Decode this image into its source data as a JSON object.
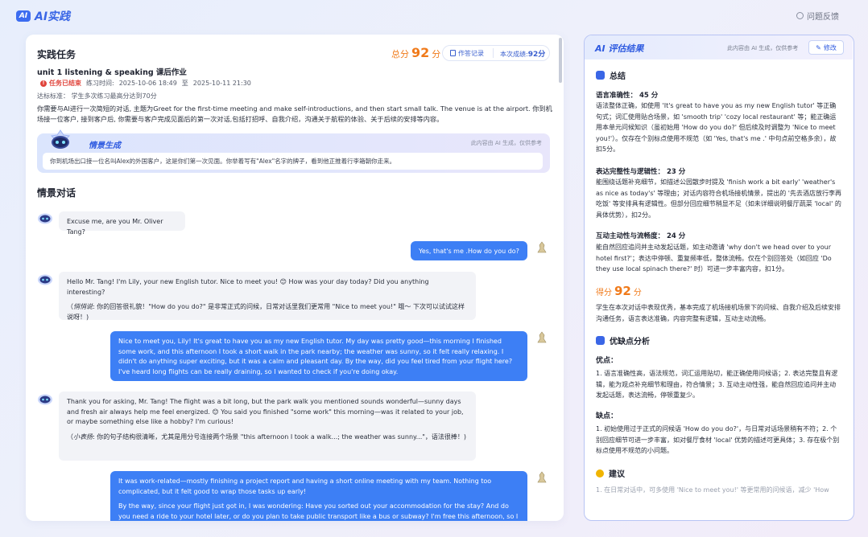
{
  "app": {
    "logo_badge": "AI",
    "logo_text": "AI实践",
    "feedback_label": "问题反馈"
  },
  "task": {
    "section_title": "实践任务",
    "total_score_prefix": "总分",
    "total_score": "92",
    "total_score_suffix": "分",
    "record_label": "作答记录",
    "current_score_label": "本次成绩:",
    "current_score_value": "92分",
    "homework_title": "unit 1 listening & speaking 课后作业",
    "status": "任务已结束",
    "time_label": "练习时间:",
    "time_start": "2025-10-06 18:49",
    "time_to": "至",
    "time_end": "2025-10-11 21:30",
    "standard": "达标标准： 学生多次练习最高分达到70分",
    "description": "你需要与AI进行一次简短的对话, 主题为Greet for the first-time meeting and make self-introductions, and then start small talk. The venue is at the airport. 你到机场接一位客户, 接到客户后, 你需要与客户完成见面后的第一次对话,包括打招呼、自我介绍，沟通关于航程的体验、关于后续的安排等内容。"
  },
  "scene": {
    "label": "情景生成",
    "note": "此内容由 AI 生成，仅供参考",
    "text": "你到机场出口接一位名叫Alex的外国客户，这是你们第一次见面。你举着写有\"Alex\"名字的牌子，看到他正推着行李箱朝你走来。"
  },
  "dialog": {
    "title": "情景对话",
    "messages": [
      {
        "role": "bot",
        "text": "Excuse me, are you Mr. Oliver Tang?"
      },
      {
        "role": "user",
        "text": "Yes, that's me .How do you do?"
      },
      {
        "role": "bot",
        "text": "Hello Mr. Tang! I'm Lily, your new English tutor. Nice to meet you! 😊 How was your day today? Did you anything interesting?",
        "coach_label": "悄悄说",
        "coach": ": 你的回答很礼貌！\"How do you do?\" 是非常正式的问候，日常对话里我们更常用 \"Nice to meet you!\" 哦～ 下次可以试试这样说呀！)"
      },
      {
        "role": "user",
        "text": "Nice to meet you, Lily! It's great to have you as my new English tutor. My day was pretty good—this morning I finished some work, and this afternoon I took a short walk in the park nearby; the weather was sunny, so it felt really relaxing. I didn't do anything super exciting, but it was a calm and pleasant day. By the way, did you feel tired from your flight here? I've heard long flights can be really draining, so I wanted to check if you're doing okay."
      },
      {
        "role": "bot",
        "text": "Thank you for asking, Mr. Tang! The flight was a bit long, but the park walk you mentioned sounds wonderful—sunny days and fresh air always help me feel energized. 😊 You said you finished \"some work\" this morning—was it related to your job, or maybe something else like a hobby? I'm curious!",
        "coach_label": "小表扬",
        "coach": ": 你的句子结构很清晰，尤其是用分号连接两个场景 \"this afternoon I took a walk...; the weather was sunny...\"，语法很棒！)"
      },
      {
        "role": "user",
        "text": "It was work-related—mostly finishing a project report and having a short online meeting with my team. Nothing too complicated, but it felt good to wrap those tasks up early!",
        "text2": "By the way, since your flight just got in, I was wondering: Have you sorted out your accommodation for the stay? And do you need a ride to your hotel later, or do you plan to take public transport like a bus or subway? I'm free this afternoon, so I can help."
      }
    ]
  },
  "result": {
    "title": "AI 评估结果",
    "note": "此内容由 AI 生成，仅供参考",
    "edit_label": "修改",
    "summary_title": "总结",
    "criteria": [
      {
        "title": "语言准确性： 45 分",
        "body": "语法整体正确，如使用 'It's great to have you as my new English tutor' 等正确句式；词汇使用贴合场景，如 'smooth trip' 'cozy local restaurant' 等；能正确运用本单元问候知识（虽初始用 'How do you do?' 但后续及时调整为 'Nice to meet you!'）。仅存在个别标点使用不规范（如 'Yes, that's me .' 中句点前空格多余），故扣5分。"
      },
      {
        "title": "表达完整性与逻辑性： 23 分",
        "body": "能围绕话题补充细节，如描述公园散步时提及 'finish work a bit early' 'weather's as nice as today's' 等理由；对话内容符合机场接机情景，提出的 '先去酒店放行李再吃饭' 等安排具有逻辑性。但部分回应细节稍显不足（如未详细说明餐厅蔬菜 'local' 的具体优势），扣2分。"
      },
      {
        "title": "互动主动性与流畅度： 24 分",
        "body": "能自然回应追问并主动发起话题，如主动邀请 'why don't we head over to your hotel first?'；表达中停顿、重复频率低，整体流畅。仅在个别回答处（如回应 'Do they use local spinach there?' 时）可进一步丰富内容，扣1分。"
      }
    ],
    "final_prefix": "得分",
    "final_score": "92",
    "final_suffix": "分",
    "final_comment": "学生在本次对话中表现优秀，基本完成了机场接机场景下的问候、自我介绍及后续安排沟通任务，语言表达准确，内容完整有逻辑，互动主动流畅。",
    "analysis_title": "优缺点分析",
    "pros_label": "优点：",
    "pros": "1. 语言准确性高，语法规范，词汇运用贴切，能正确使用问候语；2. 表达完整且有逻辑，能为观点补充细节和理由，符合情景；3. 互动主动性强，能自然回应追问并主动发起话题，表达流畅，停顿重复少。",
    "cons_label": "缺点：",
    "cons": "1. 初始使用过于正式的问候语 'How do you do?'，与日常对话场景稍有不符；2. 个别回应细节可进一步丰富，如对餐厅食材 'local' 优势的描述可更具体；3. 存在极个别标点使用不规范的小问题。",
    "suggest_title": "建议",
    "suggest_partial": "1. 在日常对话中，可多使用 'Nice to meet you!' 等更常用的问候语，减少 'How"
  },
  "colors": {
    "accent": "#3d7ff5",
    "score": "#f07a1a",
    "danger": "#e0443b"
  }
}
